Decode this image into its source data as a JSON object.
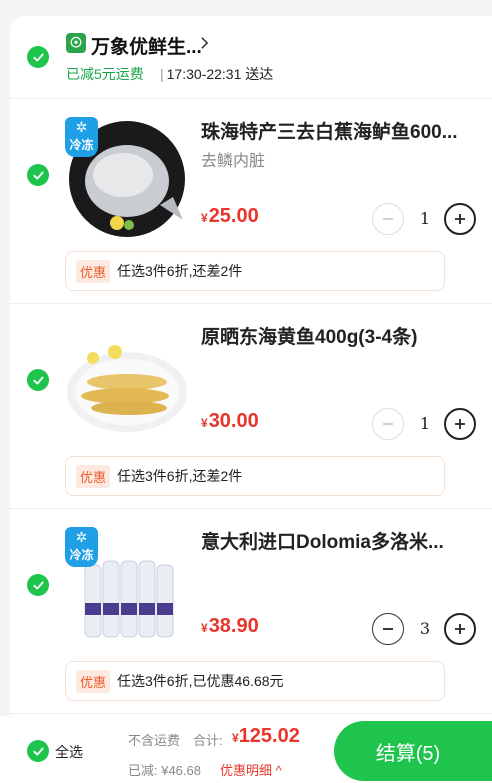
{
  "store": {
    "name": "万象优鲜生...",
    "promo": "已减5元运费",
    "delivery_time": "17:30-22:31 送达",
    "separator": "|"
  },
  "items": [
    {
      "title": "珠海特产三去白蕉海鲈鱼600...",
      "subtitle": "去鳞内脏",
      "price_symbol": "¥",
      "price": "25.00",
      "quantity": "1",
      "frozen_label": "冷冻",
      "offer_tag": "优惠",
      "offer_text": "任选3件6折,还差2件"
    },
    {
      "title": "原晒东海黄鱼400g(3-4条)",
      "subtitle": "",
      "price_symbol": "¥",
      "price": "30.00",
      "quantity": "1",
      "offer_tag": "优惠",
      "offer_text": "任选3件6折,还差2件"
    },
    {
      "title": "意大利进口Dolomia多洛米...",
      "subtitle": "",
      "price_symbol": "¥",
      "price": "38.90",
      "quantity": "3",
      "frozen_label": "冷冻",
      "offer_tag": "优惠",
      "offer_text": "任选3件6折,已优惠46.68元"
    }
  ],
  "footer": {
    "select_all": "全选",
    "shipping_note": "不含运费",
    "total_label": "合计:",
    "total_symbol": "¥",
    "total": "125.02",
    "saved": "已减: ¥46.68",
    "detail_link": "优惠明细 ^",
    "checkout": "结算(5)"
  },
  "colors": {
    "accent_green": "#1fc44d",
    "price_red": "#e8362c",
    "offer_orange": "#ef5b2a"
  }
}
